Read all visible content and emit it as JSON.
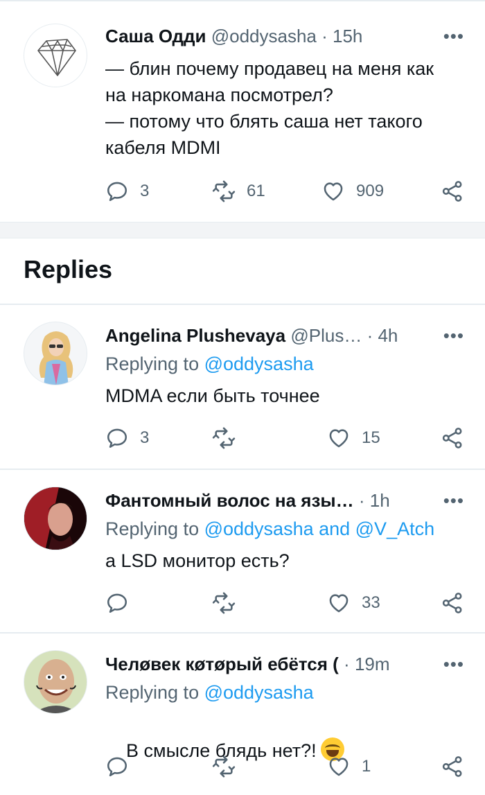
{
  "main_tweet": {
    "name": "Саша Одди",
    "handle": "@oddysasha",
    "time": "15h",
    "text": "— блин почему продавец на меня как\nна наркомана посмотрел?\n— потому что блять саша нет такого\nкабеля MDMI",
    "replies": "3",
    "retweets": "61",
    "likes": "909"
  },
  "replies_title": "Replies",
  "replies": [
    {
      "name": "Angelina Plushevaya",
      "handle": "@Plus…",
      "time": "4h",
      "replying_to_prefix": "Replying to ",
      "mention": "@oddysasha",
      "text": "MDMA если быть точнее",
      "replies": "3",
      "retweets": "",
      "likes": "15"
    },
    {
      "name": "Фантомный волос на язы…",
      "handle": "",
      "time": "1h",
      "replying_to_prefix": "Replying to ",
      "mention": "@oddysasha and @V_Atch",
      "text": "а LSD монитор есть?",
      "replies": "",
      "retweets": "",
      "likes": "33"
    },
    {
      "name": "Челøвек кøтøрый ебётся (",
      "handle": "",
      "time": "19m",
      "replying_to_prefix": "Replying to ",
      "mention": "@oddysasha",
      "text": "В смысле блядь нет?!",
      "replies": "",
      "retweets": "",
      "likes": "1"
    }
  ],
  "colors": {
    "accent": "#1d9bf0",
    "secondary": "#536471",
    "text": "#0f1419",
    "divider": "#e6ecf0"
  },
  "icons": [
    "diamond-icon",
    "reply-icon",
    "retweet-icon",
    "like-icon",
    "share-icon",
    "more-icon",
    "joy-emoji-icon"
  ]
}
